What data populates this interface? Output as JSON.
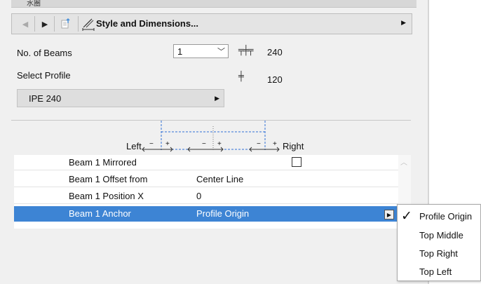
{
  "header_fragment": "水圏",
  "nav": {
    "prev_icon": "triangle-left",
    "next_icon": "triangle-right",
    "page_icon": "page-arrow",
    "panel_icon": "style-dimensions",
    "title": "Style and Dimensions...",
    "menu_icon": "triangle-right"
  },
  "beams": {
    "count_label": "No. of Beams",
    "count_value": "1",
    "height_icon": "profile-height",
    "height_value": "240",
    "width_icon": "profile-width",
    "width_value": "120"
  },
  "profile": {
    "label": "Select Profile",
    "value": "IPE 240"
  },
  "diagram": {
    "left_label": "Left",
    "right_label": "Right",
    "minus": "−",
    "plus": "+"
  },
  "table": {
    "rows": [
      {
        "key": "Beam 1 Mirrored",
        "value": "",
        "checkbox": false
      },
      {
        "key": "Beam 1 Offset from",
        "value": "Center Line"
      },
      {
        "key": "Beam 1 Position X",
        "value": "0"
      },
      {
        "key": "Beam 1 Anchor",
        "value": "Profile Origin",
        "selected": true
      }
    ]
  },
  "dropdown": {
    "options": [
      "Profile Origin",
      "Top Middle",
      "Top Right",
      "Top Left"
    ],
    "selected": "Profile Origin"
  },
  "colors": {
    "selection": "#3d84d4",
    "panel_bg": "#f0f0f0",
    "guide": "#2f6fd6"
  }
}
